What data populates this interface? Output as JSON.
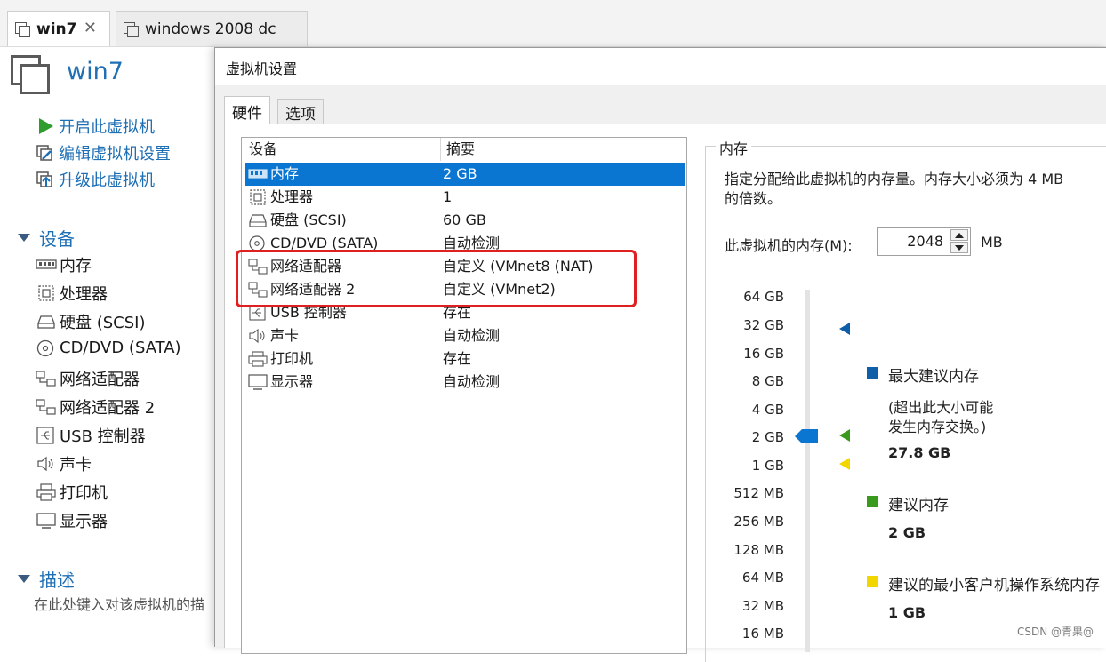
{
  "tabs": [
    {
      "label": "win7",
      "active": true
    },
    {
      "label": "windows 2008 dc",
      "active": false
    }
  ],
  "left": {
    "vm_name": "win7",
    "actions": [
      "开启此虚拟机",
      "编辑虚拟机设置",
      "升级此虚拟机"
    ],
    "devices_header": "设备",
    "devices": [
      {
        "name": "内存",
        "icon": "memory-icon"
      },
      {
        "name": "处理器",
        "icon": "processor-icon"
      },
      {
        "name": "硬盘 (SCSI)",
        "icon": "harddisk-icon"
      },
      {
        "name": "CD/DVD (SATA)",
        "icon": "cd-dvd-icon"
      },
      {
        "name": "网络适配器",
        "icon": "network-adapter-icon"
      },
      {
        "name": "网络适配器 2",
        "icon": "network-adapter-icon"
      },
      {
        "name": "USB 控制器",
        "icon": "usb-icon"
      },
      {
        "name": "声卡",
        "icon": "sound-icon"
      },
      {
        "name": "打印机",
        "icon": "printer-icon"
      },
      {
        "name": "显示器",
        "icon": "display-icon"
      }
    ],
    "desc_header": "描述",
    "desc_placeholder": "在此处键入对该虚拟机的描"
  },
  "dialog": {
    "title": "虚拟机设置",
    "tabs": [
      "硬件",
      "选项"
    ],
    "list_headers": {
      "device": "设备",
      "summary": "摘要"
    },
    "rows": [
      {
        "name": "内存",
        "summary": "2 GB",
        "selected": true,
        "icon": "memory-icon"
      },
      {
        "name": "处理器",
        "summary": "1",
        "icon": "processor-icon"
      },
      {
        "name": "硬盘 (SCSI)",
        "summary": "60 GB",
        "icon": "harddisk-icon"
      },
      {
        "name": "CD/DVD (SATA)",
        "summary": "自动检测",
        "icon": "cd-dvd-icon"
      },
      {
        "name": "网络适配器",
        "summary": "自定义 (VMnet8 (NAT)",
        "icon": "network-adapter-icon"
      },
      {
        "name": "网络适配器 2",
        "summary": "自定义 (VMnet2)",
        "icon": "network-adapter-icon"
      },
      {
        "name": "USB 控制器",
        "summary": "存在",
        "icon": "usb-icon"
      },
      {
        "name": "声卡",
        "summary": "自动检测",
        "icon": "sound-icon"
      },
      {
        "name": "打印机",
        "summary": "存在",
        "icon": "printer-icon"
      },
      {
        "name": "显示器",
        "summary": "自动检测",
        "icon": "display-icon"
      }
    ],
    "memory": {
      "group_label": "内存",
      "desc_line1": "指定分配给此虚拟机的内存量。内存大小必须为 4 MB",
      "desc_line2": "的倍数。",
      "field_label": "此虚拟机的内存(M):",
      "value": "2048",
      "unit": "MB",
      "scale": [
        "64 GB",
        "32 GB",
        "16 GB",
        "8 GB",
        "4 GB",
        "2 GB",
        "1 GB",
        "512 MB",
        "256 MB",
        "128 MB",
        "64 MB",
        "32 MB",
        "16 MB"
      ],
      "legend": [
        {
          "title": "最大建议内存",
          "note_line1": "(超出此大小可能",
          "note_line2": "发生内存交换。)",
          "value": "27.8 GB",
          "color": "#0f5fa8"
        },
        {
          "title": "建议内存",
          "value": "2 GB",
          "color": "#3a9a1e"
        },
        {
          "title": "建议的最小客户机操作系统内存",
          "value": "1 GB",
          "color": "#f2d600"
        }
      ]
    }
  },
  "watermark": "CSDN @青果@"
}
